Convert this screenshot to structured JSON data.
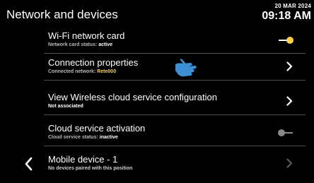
{
  "header": {
    "title": "Network and devices",
    "date": "20 MAR 2024",
    "time": "09:18 AM"
  },
  "rows": [
    {
      "label": "Wi-Fi network card",
      "sub_prefix": "Network card status: ",
      "sub_value": "active",
      "control": "toggle",
      "toggle_state": "on"
    },
    {
      "label": "Connection properties",
      "sub_prefix": "Connected network: ",
      "sub_value": "Rete000",
      "control": "chevron"
    },
    {
      "label": "View Wireless cloud service configuration",
      "sub_text": "Not associated",
      "control": "chevron"
    },
    {
      "label": "Cloud service activation",
      "sub_prefix": "Cloud service status: ",
      "sub_value": "inactive",
      "control": "toggle",
      "toggle_state": "off"
    },
    {
      "label": "Mobile device - 1",
      "sub_text": "No devices paired with this position",
      "control": "chevron",
      "control_state": "disabled"
    }
  ],
  "icons": {
    "back": "chevron-left-icon",
    "pointer": "hand-pointer-icon"
  },
  "colors": {
    "background": "#000000",
    "text": "#ffffff",
    "highlight": "#ffd24a",
    "toggle_on_knob": "#ffd24a",
    "pointer_blue": "#3d8fd6"
  }
}
